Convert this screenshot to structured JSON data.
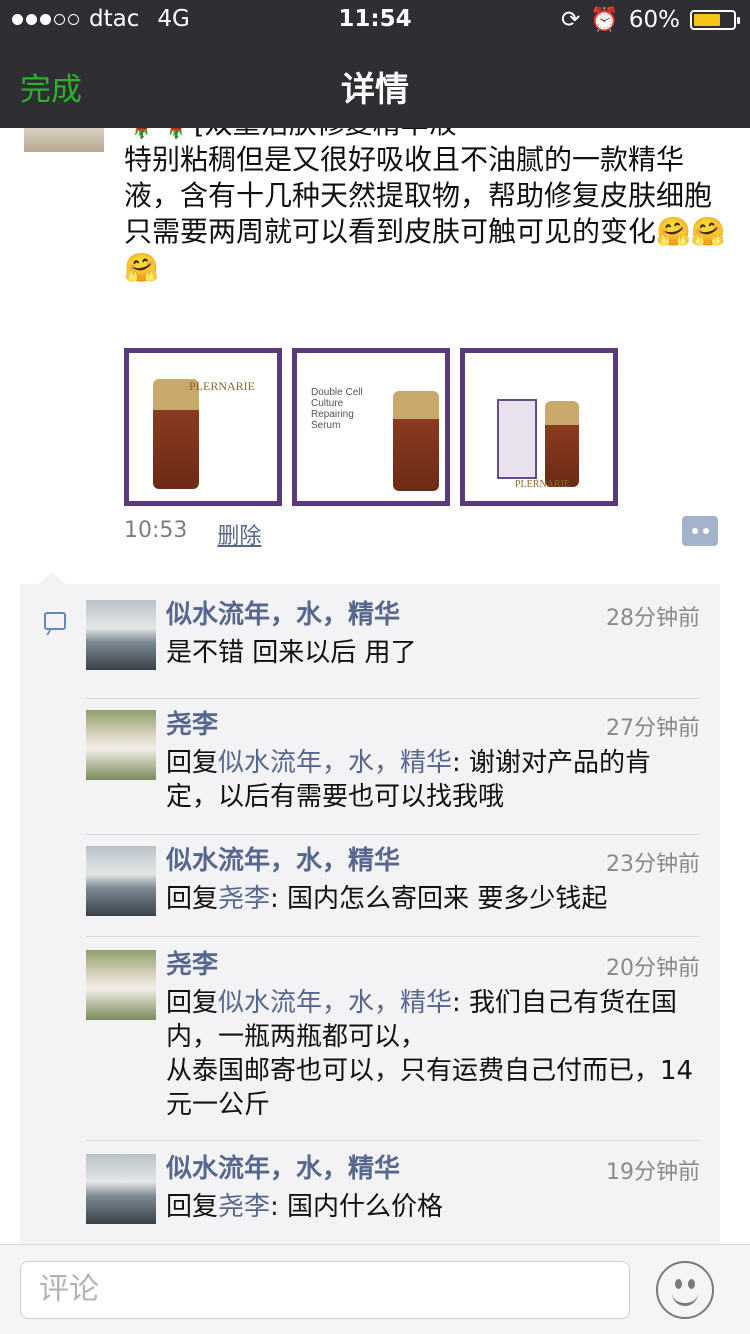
{
  "status_bar": {
    "carrier": "dtac",
    "network": "4G",
    "time": "11:54",
    "battery": "60%"
  },
  "nav": {
    "back_label": "完成",
    "title": "详情"
  },
  "post": {
    "lines": [
      "🌹🌹[双重活肤修复精华液",
      "特别粘稠但是又很好吸收且不油腻的一款精华液，含有十几种天然提取物，帮助修复皮肤细胞",
      "只需要两周就可以看到皮肤可触可见的变化🤗🤗🤗"
    ],
    "images": [
      {
        "brand": "PLERNARIE",
        "alt": "product-photo-1"
      },
      {
        "brand": "Double Cell Culture Repairing Serum",
        "alt": "product-photo-2"
      },
      {
        "brand": "PLERNARIE",
        "alt": "product-photo-3"
      }
    ],
    "time": "10:53",
    "delete_label": "删除"
  },
  "comments": [
    {
      "name": "似水流年，水，精华",
      "time": "28分钟前",
      "reply_prefix": "",
      "reply_to": "",
      "text": "是不错  回来以后  用了"
    },
    {
      "name": "尧李",
      "time": "27分钟前",
      "reply_prefix": "回复",
      "reply_to": "似水流年，水，精华",
      "text": ": 谢谢对产品的肯定，以后有需要也可以找我哦"
    },
    {
      "name": "似水流年，水，精华",
      "time": "23分钟前",
      "reply_prefix": "回复",
      "reply_to": "尧李",
      "text": ": 国内怎么寄回来  要多少钱起"
    },
    {
      "name": "尧李",
      "time": "20分钟前",
      "reply_prefix": "回复",
      "reply_to": "似水流年，水，精华",
      "text": ": 我们自己有货在国内，一瓶两瓶都可以，",
      "text2": "从泰国邮寄也可以，只有运费自己付而已，14元一公斤"
    },
    {
      "name": "似水流年，水，精华",
      "time": "19分钟前",
      "reply_prefix": "回复",
      "reply_to": "尧李",
      "text": ": 国内什么价格"
    }
  ],
  "input": {
    "placeholder": "评论"
  },
  "colors": {
    "accent_green": "#2bb22b",
    "link_blue": "#56688f",
    "header_bg": "#2e2e33"
  }
}
